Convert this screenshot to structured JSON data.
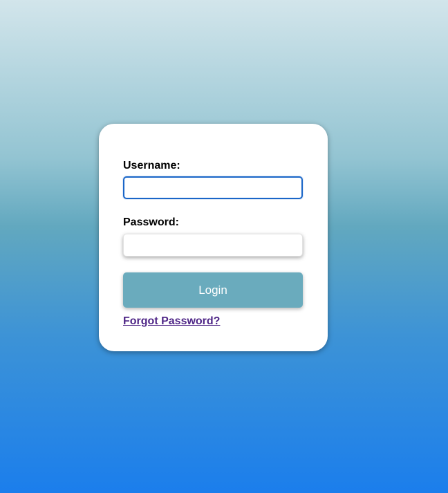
{
  "login_form": {
    "username_label": "Username:",
    "username_value": "",
    "password_label": "Password:",
    "password_value": "",
    "login_button_label": "Login",
    "forgot_password_link": "Forgot Password?"
  },
  "colors": {
    "button_background": "#6aabbd",
    "link_color": "#4f2687",
    "focused_input_border": "#1a66c8"
  }
}
